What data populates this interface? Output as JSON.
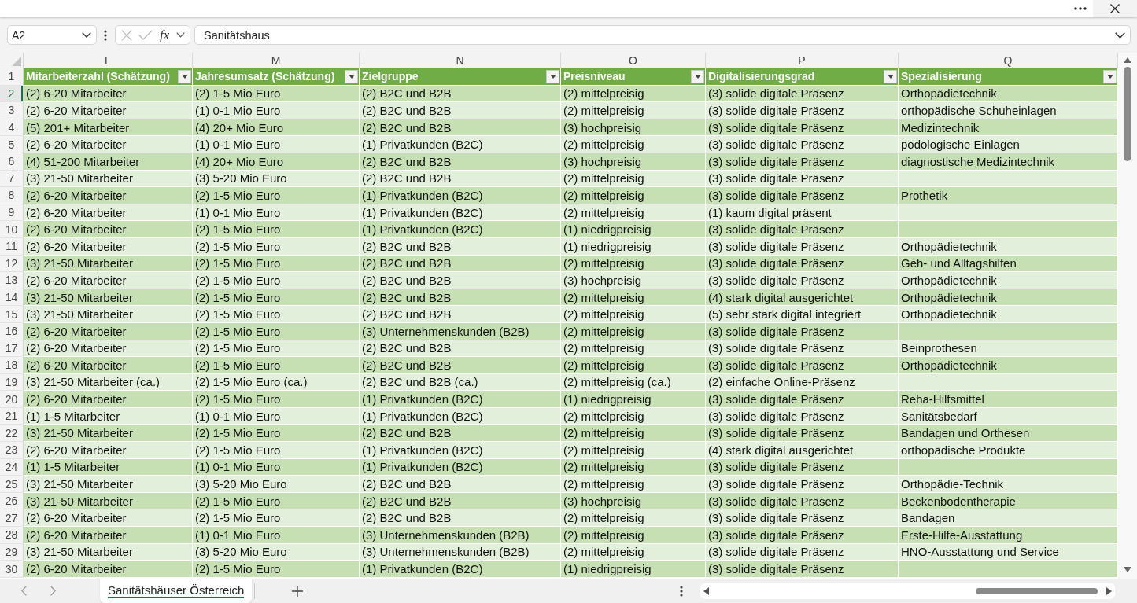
{
  "formula_bar": {
    "name_box": "A2",
    "cancel_button": {
      "disabled": true
    },
    "enter_button": {
      "disabled": true
    },
    "function_button": "fx",
    "content": "Sanitätshaus"
  },
  "sheet": {
    "column_letters": [
      "L",
      "M",
      "N",
      "O",
      "P",
      "Q"
    ],
    "header_row": {
      "number": "1",
      "columns": [
        {
          "title": "Mitarbeiterzahl (Schätzung)",
          "filter": true
        },
        {
          "title": "Jahresumsatz (Schätzung)",
          "filter": true
        },
        {
          "title": "Zielgruppe",
          "filter": true
        },
        {
          "title": "Preisniveau",
          "filter": true
        },
        {
          "title": "Digitalisierungsgrad",
          "filter": true
        },
        {
          "title": "Spezialisierung",
          "filter": true
        }
      ]
    },
    "rows": [
      {
        "number": "2",
        "selected": true,
        "cells": [
          "(2) 6-20 Mitarbeiter",
          "(2) 1-5 Mio Euro",
          "(2) B2C und B2B",
          "(2) mittelpreisig",
          "(3) solide digitale Präsenz",
          "Orthopädietechnik"
        ]
      },
      {
        "number": "3",
        "selected": false,
        "cells": [
          "(2) 6-20 Mitarbeiter",
          "(1) 0-1 Mio Euro",
          "(2) B2C und B2B",
          "(2) mittelpreisig",
          "(3) solide digitale Präsenz",
          "orthopädische Schuheinlagen"
        ]
      },
      {
        "number": "4",
        "selected": false,
        "cells": [
          "(5) 201+ Mitarbeiter",
          "(4) 20+ Mio Euro",
          "(2) B2C und B2B",
          "(3) hochpreisig",
          "(3) solide digitale Präsenz",
          "Medizintechnik"
        ]
      },
      {
        "number": "5",
        "selected": false,
        "cells": [
          "(2) 6-20 Mitarbeiter",
          "(1) 0-1 Mio Euro",
          "(1) Privatkunden (B2C)",
          "(2) mittelpreisig",
          "(3) solide digitale Präsenz",
          "podologische Einlagen"
        ]
      },
      {
        "number": "6",
        "selected": false,
        "cells": [
          "(4) 51-200 Mitarbeiter",
          "(4) 20+ Mio Euro",
          "(2) B2C und B2B",
          "(3) hochpreisig",
          "(3) solide digitale Präsenz",
          "diagnostische Medizintechnik"
        ]
      },
      {
        "number": "7",
        "selected": false,
        "cells": [
          "(3) 21-50 Mitarbeiter",
          "(3) 5-20 Mio Euro",
          "(2) B2C und B2B",
          "(2) mittelpreisig",
          "(3) solide digitale Präsenz"
        ]
      },
      {
        "number": "8",
        "selected": false,
        "cells": [
          "(2) 6-20 Mitarbeiter",
          "(2) 1-5 Mio Euro",
          "(1) Privatkunden (B2C)",
          "(2) mittelpreisig",
          "(3) solide digitale Präsenz",
          "Prothetik"
        ]
      },
      {
        "number": "9",
        "selected": false,
        "cells": [
          "(2) 6-20 Mitarbeiter",
          "(1) 0-1 Mio Euro",
          "(1) Privatkunden (B2C)",
          "(2) mittelpreisig",
          "(1) kaum digital präsent"
        ]
      },
      {
        "number": "10",
        "selected": false,
        "cells": [
          "(2) 6-20 Mitarbeiter",
          "(2) 1-5 Mio Euro",
          "(1) Privatkunden (B2C)",
          "(1) niedrigpreisig",
          "(3) solide digitale Präsenz"
        ]
      },
      {
        "number": "11",
        "selected": false,
        "cells": [
          "(2) 6-20 Mitarbeiter",
          "(2) 1-5 Mio Euro",
          "(2) B2C und B2B",
          "(1) niedrigpreisig",
          "(3) solide digitale Präsenz",
          "Orthopädietechnik"
        ]
      },
      {
        "number": "12",
        "selected": false,
        "cells": [
          "(3) 21-50 Mitarbeiter",
          "(2) 1-5 Mio Euro",
          "(2) B2C und B2B",
          "(2) mittelpreisig",
          "(3) solide digitale Präsenz",
          "Geh- und Alltagshilfen"
        ]
      },
      {
        "number": "13",
        "selected": false,
        "cells": [
          "(2) 6-20 Mitarbeiter",
          "(2) 1-5 Mio Euro",
          "(2) B2C und B2B",
          "(3) hochpreisig",
          "(3) solide digitale Präsenz",
          "Orthopädietechnik"
        ]
      },
      {
        "number": "14",
        "selected": false,
        "cells": [
          "(3) 21-50 Mitarbeiter",
          "(2) 1-5 Mio Euro",
          "(2) B2C und B2B",
          "(2) mittelpreisig",
          "(4) stark digital ausgerichtet",
          "Orthopädietechnik"
        ]
      },
      {
        "number": "15",
        "selected": false,
        "cells": [
          "(3) 21-50 Mitarbeiter",
          "(2) 1-5 Mio Euro",
          "(2) B2C und B2B",
          "(2) mittelpreisig",
          "(5) sehr stark digital integriert",
          "Orthopädietechnik"
        ]
      },
      {
        "number": "16",
        "selected": false,
        "cells": [
          "(2) 6-20 Mitarbeiter",
          "(2) 1-5 Mio Euro",
          "(3) Unternehmenskunden (B2B)",
          "(2) mittelpreisig",
          "(3) solide digitale Präsenz"
        ]
      },
      {
        "number": "17",
        "selected": false,
        "cells": [
          "(2) 6-20 Mitarbeiter",
          "(2) 1-5 Mio Euro",
          "(2) B2C und B2B",
          "(2) mittelpreisig",
          "(3) solide digitale Präsenz",
          "Beinprothesen"
        ]
      },
      {
        "number": "18",
        "selected": false,
        "cells": [
          "(2) 6-20 Mitarbeiter",
          "(2) 1-5 Mio Euro",
          "(2) B2C und B2B",
          "(2) mittelpreisig",
          "(3) solide digitale Präsenz",
          "Orthopädietechnik"
        ]
      },
      {
        "number": "19",
        "selected": false,
        "cells": [
          "(3) 21-50 Mitarbeiter (ca.)",
          "(2) 1-5 Mio Euro (ca.)",
          "(2) B2C und B2B (ca.)",
          "(2) mittelpreisig (ca.)",
          "(2) einfache Online-Präsenz"
        ]
      },
      {
        "number": "20",
        "selected": false,
        "cells": [
          "(2) 6-20 Mitarbeiter",
          "(2) 1-5 Mio Euro",
          "(1) Privatkunden (B2C)",
          "(1) niedrigpreisig",
          "(3) solide digitale Präsenz",
          "Reha-Hilfsmittel"
        ]
      },
      {
        "number": "21",
        "selected": false,
        "cells": [
          "(1) 1-5 Mitarbeiter",
          "(1) 0-1 Mio Euro",
          "(1) Privatkunden (B2C)",
          "(2) mittelpreisig",
          "(3) solide digitale Präsenz",
          "Sanitätsbedarf"
        ]
      },
      {
        "number": "22",
        "selected": false,
        "cells": [
          "(3) 21-50 Mitarbeiter",
          "(2) 1-5 Mio Euro",
          "(2) B2C und B2B",
          "(2) mittelpreisig",
          "(3) solide digitale Präsenz",
          "Bandagen und Orthesen"
        ]
      },
      {
        "number": "23",
        "selected": false,
        "cells": [
          "(2) 6-20 Mitarbeiter",
          "(2) 1-5 Mio Euro",
          "(1) Privatkunden (B2C)",
          "(2) mittelpreisig",
          "(4) stark digital ausgerichtet",
          "orthopädische Produkte"
        ]
      },
      {
        "number": "24",
        "selected": false,
        "cells": [
          "(1) 1-5 Mitarbeiter",
          "(1) 0-1 Mio Euro",
          "(1) Privatkunden (B2C)",
          "(2) mittelpreisig",
          "(3) solide digitale Präsenz"
        ]
      },
      {
        "number": "25",
        "selected": false,
        "cells": [
          "(3) 21-50 Mitarbeiter",
          "(3) 5-20 Mio Euro",
          "(2) B2C und B2B",
          "(2) mittelpreisig",
          "(3) solide digitale Präsenz",
          "Orthopädie-Technik"
        ]
      },
      {
        "number": "26",
        "selected": false,
        "cells": [
          "(3) 21-50 Mitarbeiter",
          "(2) 1-5 Mio Euro",
          "(2) B2C und B2B",
          "(3) hochpreisig",
          "(3) solide digitale Präsenz",
          "Beckenbodentherapie"
        ]
      },
      {
        "number": "27",
        "selected": false,
        "cells": [
          "(2) 6-20 Mitarbeiter",
          "(2) 1-5 Mio Euro",
          "(2) B2C und B2B",
          "(2) mittelpreisig",
          "(3) solide digitale Präsenz",
          "Bandagen"
        ]
      },
      {
        "number": "28",
        "selected": false,
        "cells": [
          "(2) 6-20 Mitarbeiter",
          "(1) 0-1 Mio Euro",
          "(3) Unternehmenskunden (B2B)",
          "(2) mittelpreisig",
          "(3) solide digitale Präsenz",
          "Erste-Hilfe-Ausstattung"
        ]
      },
      {
        "number": "29",
        "selected": false,
        "cells": [
          "(3) 21-50 Mitarbeiter",
          "(3) 5-20 Mio Euro",
          "(3) Unternehmenskunden (B2B)",
          "(2) mittelpreisig",
          "(3) solide digitale Präsenz",
          "HNO-Ausstattung und Service"
        ]
      },
      {
        "number": "30",
        "selected": false,
        "cells": [
          "(2) 6-20 Mitarbeiter",
          "(2) 1-5 Mio Euro",
          "(1) Privatkunden (B2C)",
          "(1) niedrigpreisig",
          "(3) solide digitale Präsenz"
        ]
      }
    ]
  },
  "sheet_tabs": [
    {
      "label": "Sanitätshäuser Österreich",
      "selected": true
    }
  ]
}
